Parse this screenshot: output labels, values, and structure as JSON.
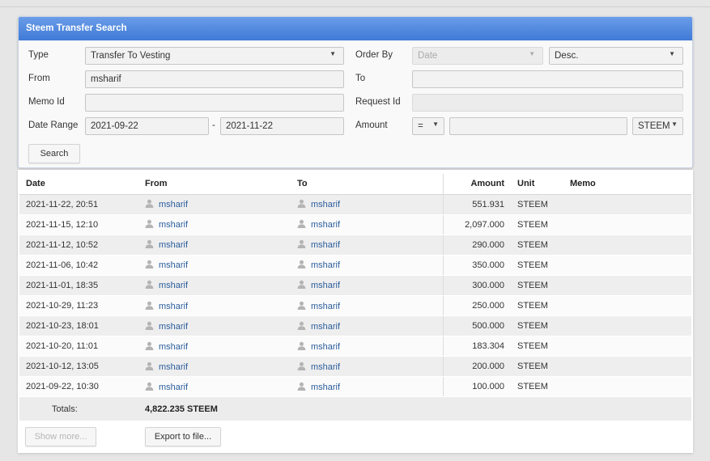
{
  "panel": {
    "title": "Steem Transfer Search",
    "type_label": "Type",
    "type_value": "Transfer To Vesting",
    "order_by_label": "Order By",
    "order_by_value": "Date",
    "order_dir_value": "Desc.",
    "from_label": "From",
    "from_value": "msharif",
    "to_label": "To",
    "to_value": "",
    "memo_id_label": "Memo Id",
    "memo_id_value": "",
    "request_id_label": "Request Id",
    "request_id_value": "",
    "date_range_label": "Date Range",
    "date_from": "2021-09-22",
    "date_sep": "-",
    "date_to": "2021-11-22",
    "amount_label": "Amount",
    "amount_op": "=",
    "amount_value": "",
    "amount_unit": "STEEM",
    "search_label": "Search"
  },
  "icons": {
    "dropdown": "chevron-down-icon",
    "user": "user-icon"
  },
  "colors": {
    "header": "#3f7ad6",
    "link": "#2b5d9c"
  },
  "table": {
    "headers": {
      "date": "Date",
      "from": "From",
      "to": "To",
      "amount": "Amount",
      "unit": "Unit",
      "memo": "Memo"
    },
    "rows": [
      {
        "date": "2021-11-22, 20:51",
        "from": "msharif",
        "to": "msharif",
        "amount": "551.931",
        "unit": "STEEM",
        "memo": ""
      },
      {
        "date": "2021-11-15, 12:10",
        "from": "msharif",
        "to": "msharif",
        "amount": "2,097.000",
        "unit": "STEEM",
        "memo": ""
      },
      {
        "date": "2021-11-12, 10:52",
        "from": "msharif",
        "to": "msharif",
        "amount": "290.000",
        "unit": "STEEM",
        "memo": ""
      },
      {
        "date": "2021-11-06, 10:42",
        "from": "msharif",
        "to": "msharif",
        "amount": "350.000",
        "unit": "STEEM",
        "memo": ""
      },
      {
        "date": "2021-11-01, 18:35",
        "from": "msharif",
        "to": "msharif",
        "amount": "300.000",
        "unit": "STEEM",
        "memo": ""
      },
      {
        "date": "2021-10-29, 11:23",
        "from": "msharif",
        "to": "msharif",
        "amount": "250.000",
        "unit": "STEEM",
        "memo": ""
      },
      {
        "date": "2021-10-23, 18:01",
        "from": "msharif",
        "to": "msharif",
        "amount": "500.000",
        "unit": "STEEM",
        "memo": ""
      },
      {
        "date": "2021-10-20, 11:01",
        "from": "msharif",
        "to": "msharif",
        "amount": "183.304",
        "unit": "STEEM",
        "memo": ""
      },
      {
        "date": "2021-10-12, 13:05",
        "from": "msharif",
        "to": "msharif",
        "amount": "200.000",
        "unit": "STEEM",
        "memo": ""
      },
      {
        "date": "2021-09-22, 10:30",
        "from": "msharif",
        "to": "msharif",
        "amount": "100.000",
        "unit": "STEEM",
        "memo": ""
      }
    ],
    "totals_label": "Totals:",
    "totals_value": "4,822.235 STEEM"
  },
  "footer": {
    "show_more_label": "Show more...",
    "export_label": "Export to file..."
  }
}
